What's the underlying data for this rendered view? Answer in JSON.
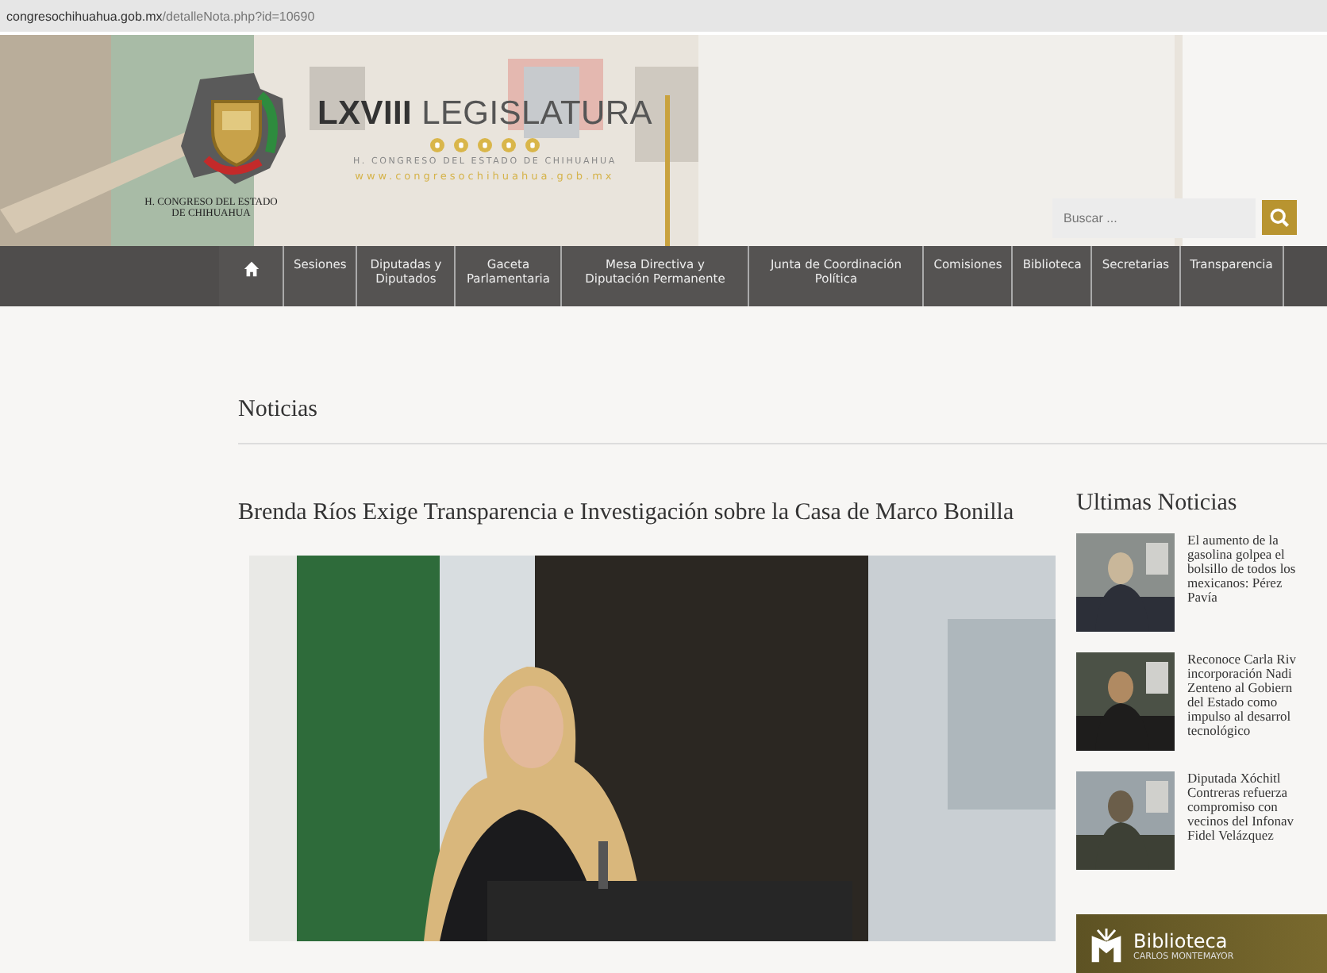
{
  "address_bar": {
    "url": "**congresochihuahua.gob.mx**/detalleNota.php?id=10690"
  },
  "header": {
    "kind": "picture",
    "emblem_caption": [
      "H. CONGRESO DEL ESTADO",
      "DE CHIHUAHUA"
    ],
    "title": "**LXVIII** LEGISLATURA",
    "subtitle": "H. CONGRESO DEL ESTADO DE CHIHUAHUA",
    "website": "www.congresochihuahua.gob.mx",
    "search": {
      "placeholder": "Buscar ..."
    }
  },
  "nav": [
    {
      "kind": "home"
    },
    {
      "kind": "text",
      "label": "Sesiones"
    },
    {
      "kind": "text",
      "label": "Diputadas y Diputados"
    },
    {
      "kind": "text",
      "label": "Gaceta Parlamentaria"
    },
    {
      "kind": "text",
      "label": "Mesa Directiva y Diputación Permanente"
    },
    {
      "kind": "text",
      "label": "Junta de Coordinación Política"
    },
    {
      "kind": "text",
      "label": "Comisiones"
    },
    {
      "kind": "text",
      "label": "Biblioteca"
    },
    {
      "kind": "text",
      "label": "Secretarias"
    },
    {
      "kind": "text",
      "label": "Transparencia"
    }
  ],
  "section_title": "Noticias",
  "article": {
    "title": "Brenda Ríos Exige Transparencia e Investigación sobre la Casa de Marco Bonilla"
  },
  "sidebar": {
    "title": "Ultimas Noticias",
    "items": [
      {
        "title_lines": [
          "El aumento de la",
          "gasolina golpea el",
          "bolsillo de todos los",
          "mexicanos: Pérez",
          "Pavía"
        ]
      },
      {
        "title_lines": [
          "Reconoce Carla Riv",
          "incorporación Nadi",
          "Zenteno al Gobiern",
          "del Estado como",
          "impulso al desarrol",
          "tecnológico"
        ]
      },
      {
        "title_lines": [
          "Diputada Xóchitl",
          "Contreras refuerza",
          "compromiso con",
          "vecinos del Infonav",
          "Fidel Velázquez"
        ]
      }
    ],
    "banner": {
      "title": "Biblioteca",
      "subtitle": "CARLOS MONTEMAYOR"
    }
  }
}
